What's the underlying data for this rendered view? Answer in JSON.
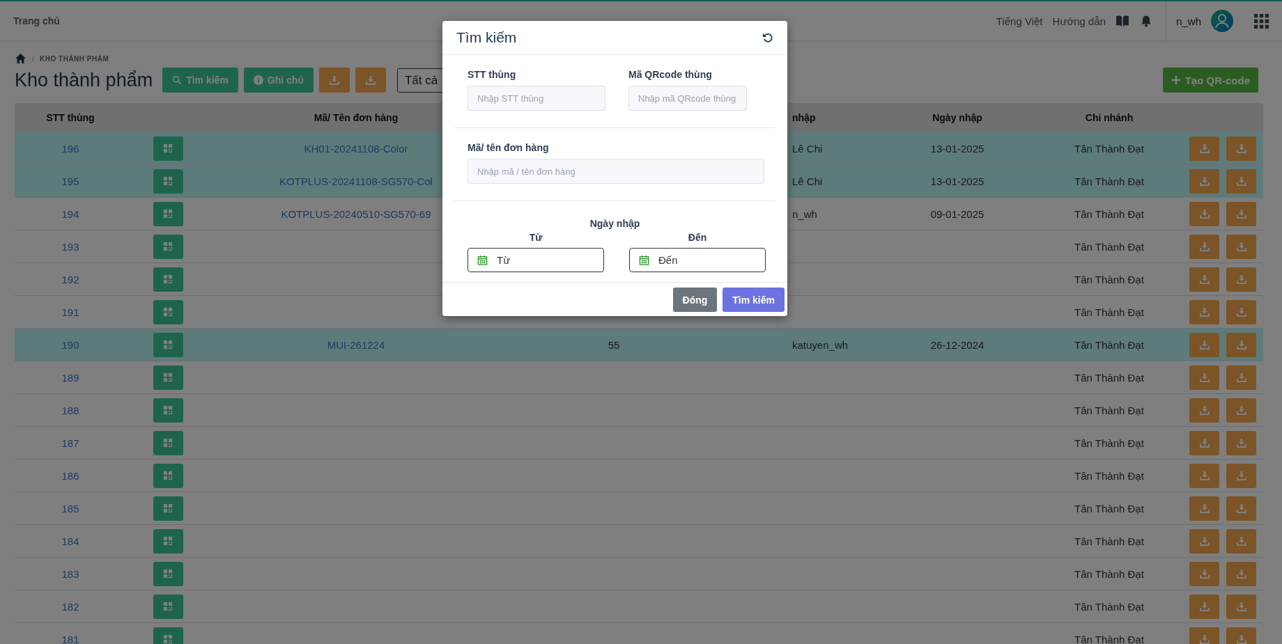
{
  "topbar": {
    "home": "Trang chủ",
    "language": "Tiếng Việt",
    "guide": "Hướng dẫn",
    "username": "n_wh"
  },
  "page": {
    "breadcrumb_separator": "/",
    "breadcrumb": "KHO THÀNH PHẨM",
    "title": "Kho thành phẩm",
    "buttons": [
      {
        "kind": "search",
        "label": "Tìm kiếm"
      },
      {
        "kind": "note",
        "label": "Ghi chú"
      },
      {
        "kind": "download"
      },
      {
        "kind": "download"
      }
    ],
    "filter": {
      "value": "Tất cả"
    },
    "create_button": "Tạo QR-code"
  },
  "table": {
    "columns": {
      "stt": "STT thùng",
      "order": "Mã/ Tên đơn hàng",
      "column_4": "nhập",
      "date": "Ngày nhập",
      "branch": "Chi nhánh"
    },
    "rows": [
      {
        "stt": "196",
        "order": "KH01-20241108-Color",
        "column_4": "Lê Chi",
        "date": "13-01-2025",
        "branch": "Tân Thành Đạt",
        "highlighted": true
      },
      {
        "stt": "195",
        "order": "KOTPLUS-20241108-SG570-Col",
        "column_4": "Lê Chi",
        "date": "13-01-2025",
        "branch": "Tân Thành Đạt",
        "highlighted": true
      },
      {
        "stt": "194",
        "order": "KOTPLUS-20240510-SG570-69",
        "column_4": "n_wh",
        "date": "09-01-2025",
        "branch": "Tân Thành Đạt",
        "highlighted": false
      },
      {
        "stt": "193",
        "branch": "Tân Thành Đạt",
        "highlighted": false
      },
      {
        "stt": "192",
        "branch": "Tân Thành Đạt",
        "highlighted": false
      },
      {
        "stt": "191",
        "branch": "Tân Thành Đạt",
        "highlighted": false
      },
      {
        "stt": "190",
        "order": "MUI-261224",
        "column_3": "55",
        "column_4": "katuyen_wh",
        "date": "26-12-2024",
        "branch": "Tân Thành Đạt",
        "highlighted": true
      },
      {
        "stt": "189",
        "branch": "Tân Thành Đạt",
        "highlighted": false
      },
      {
        "stt": "188",
        "branch": "Tân Thành Đạt",
        "highlighted": false
      },
      {
        "stt": "187",
        "branch": "Tân Thành Đạt",
        "highlighted": false
      },
      {
        "stt": "186",
        "branch": "Tân Thành Đạt",
        "highlighted": false
      },
      {
        "stt": "185",
        "branch": "Tân Thành Đạt",
        "highlighted": false
      },
      {
        "stt": "184",
        "branch": "Tân Thành Đạt",
        "highlighted": false
      },
      {
        "stt": "183",
        "branch": "Tân Thành Đạt",
        "highlighted": false
      },
      {
        "stt": "182",
        "branch": "Tân Thành Đạt",
        "highlighted": false
      },
      {
        "stt": "181",
        "branch": "Tân Thành Đạt",
        "highlighted": false
      }
    ]
  },
  "modal": {
    "title": "Tìm kiếm",
    "fields": [
      {
        "label": "STT thùng",
        "placeholder": "Nhập STT thùng"
      },
      {
        "label": "Mã QRcode thùng",
        "placeholder": "Nhập mã QRcode thùng"
      },
      {
        "label": "Mã/ tên đơn hàng",
        "placeholder": "Nhập mã / tên đơn hàng"
      }
    ],
    "date_section": {
      "title": "Ngày nhập",
      "from": {
        "label": "Từ",
        "placeholder": "Từ"
      },
      "to": {
        "label": "Đến",
        "placeholder": "Đến"
      }
    },
    "buttons": [
      {
        "kind": "secondary",
        "label": "Đóng"
      },
      {
        "kind": "primary",
        "label": "Tìm kiếm"
      }
    ]
  }
}
